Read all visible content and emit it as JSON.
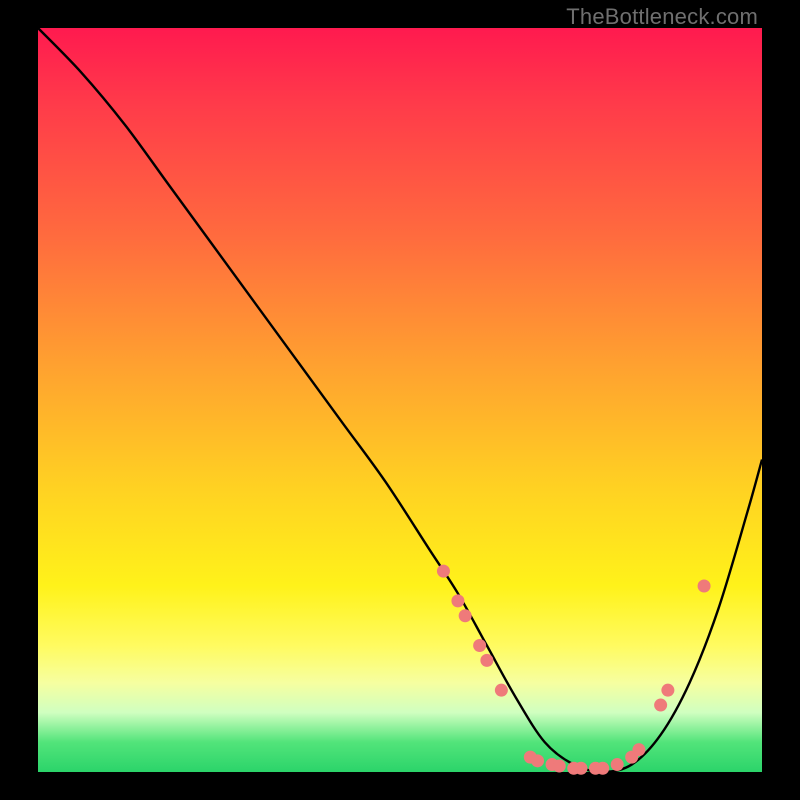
{
  "watermark": "TheBottleneck.com",
  "chart_data": {
    "type": "line",
    "title": "",
    "xlabel": "",
    "ylabel": "",
    "xlim": [
      0,
      100
    ],
    "ylim": [
      0,
      100
    ],
    "series": [
      {
        "name": "bottleneck-curve",
        "x": [
          0,
          6,
          12,
          18,
          24,
          30,
          36,
          42,
          48,
          54,
          58,
          62,
          66,
          70,
          74,
          78,
          82,
          86,
          90,
          94,
          98,
          100
        ],
        "y": [
          100,
          94,
          87,
          79,
          71,
          63,
          55,
          47,
          39,
          30,
          24,
          17,
          10,
          4,
          1,
          0,
          1,
          5,
          12,
          22,
          35,
          42
        ]
      }
    ],
    "markers": {
      "name": "highlight-dots",
      "color": "#ef7a7a",
      "points": [
        {
          "x": 56,
          "y": 27
        },
        {
          "x": 58,
          "y": 23
        },
        {
          "x": 59,
          "y": 21
        },
        {
          "x": 61,
          "y": 17
        },
        {
          "x": 62,
          "y": 15
        },
        {
          "x": 64,
          "y": 11
        },
        {
          "x": 68,
          "y": 2
        },
        {
          "x": 69,
          "y": 1.5
        },
        {
          "x": 71,
          "y": 1
        },
        {
          "x": 72,
          "y": 0.8
        },
        {
          "x": 74,
          "y": 0.5
        },
        {
          "x": 75,
          "y": 0.5
        },
        {
          "x": 77,
          "y": 0.5
        },
        {
          "x": 78,
          "y": 0.5
        },
        {
          "x": 80,
          "y": 1
        },
        {
          "x": 82,
          "y": 2
        },
        {
          "x": 83,
          "y": 3
        },
        {
          "x": 86,
          "y": 9
        },
        {
          "x": 87,
          "y": 11
        },
        {
          "x": 92,
          "y": 25
        }
      ]
    }
  }
}
